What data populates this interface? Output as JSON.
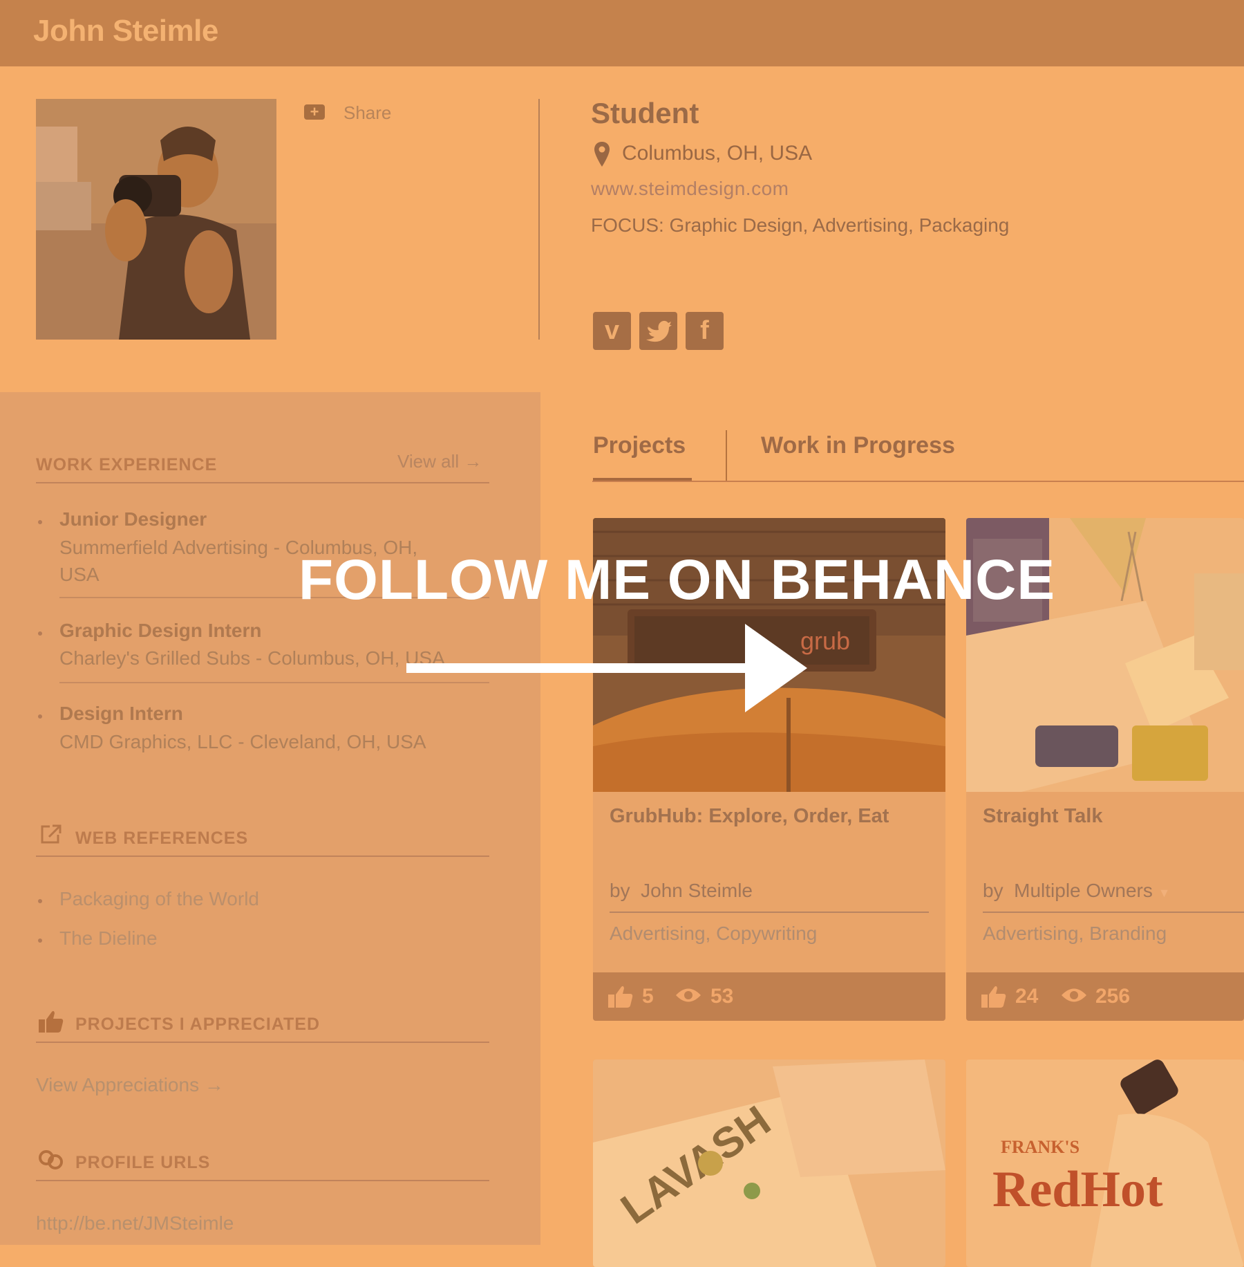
{
  "header": {
    "name": "John Steimle"
  },
  "profile": {
    "share_label": "Share",
    "share_icon": "plus-icon",
    "role": "Student",
    "location": "Columbus, OH, USA",
    "website": "www.steimdesign.com",
    "focus": "FOCUS: Graphic Design, Advertising, Packaging",
    "social": [
      {
        "icon": "vimeo-icon",
        "glyph": "v"
      },
      {
        "icon": "twitter-icon",
        "glyph": "t"
      },
      {
        "icon": "facebook-icon",
        "glyph": "f"
      }
    ]
  },
  "sidebar": {
    "work_experience": {
      "title": "WORK EXPERIENCE",
      "view_all": "View all →",
      "items": [
        {
          "title": "Junior Designer",
          "company_line1": "Summerfield Advertising - Columbus, OH,",
          "company_line2": "USA"
        },
        {
          "title": "Graphic Design Intern",
          "company_line1": "Charley's Grilled Subs - Columbus, OH, USA"
        },
        {
          "title": "Design Intern",
          "company_line1": "CMD Graphics, LLC - Cleveland, OH, USA"
        }
      ]
    },
    "web_references": {
      "title": "WEB REFERENCES",
      "items": [
        "Packaging of the World",
        "The Dieline"
      ]
    },
    "appreciated": {
      "title": "PROJECTS I APPRECIATED",
      "link": "View Appreciations →"
    },
    "profile_urls": {
      "title": "PROFILE URLS",
      "url": "http://be.net/JMSteimle"
    }
  },
  "main": {
    "tabs": [
      {
        "label": "Projects",
        "active": true
      },
      {
        "label": "Work in Progress",
        "active": false
      }
    ],
    "projects": [
      {
        "title": "GrubHub: Explore, Order, Eat",
        "by_prefix": "by",
        "owner": "John Steimle",
        "fields": "Advertising, Copywriting",
        "likes": "5",
        "views": "53",
        "sign_text": "grub"
      },
      {
        "title": "Straight Talk",
        "by_prefix": "by",
        "owner": "Multiple Owners",
        "fields": "Advertising, Branding",
        "likes": "24",
        "views": "256"
      }
    ],
    "thumbs": [
      {
        "brand": "LAVASH"
      },
      {
        "brand": "RedHot",
        "brand_top": "FRANK'S"
      }
    ]
  },
  "overlay": {
    "text": "FOLLOW ME ON BEHANCE"
  },
  "colors": {
    "overlay": "#f6ad69",
    "accent": "#a7693e"
  }
}
